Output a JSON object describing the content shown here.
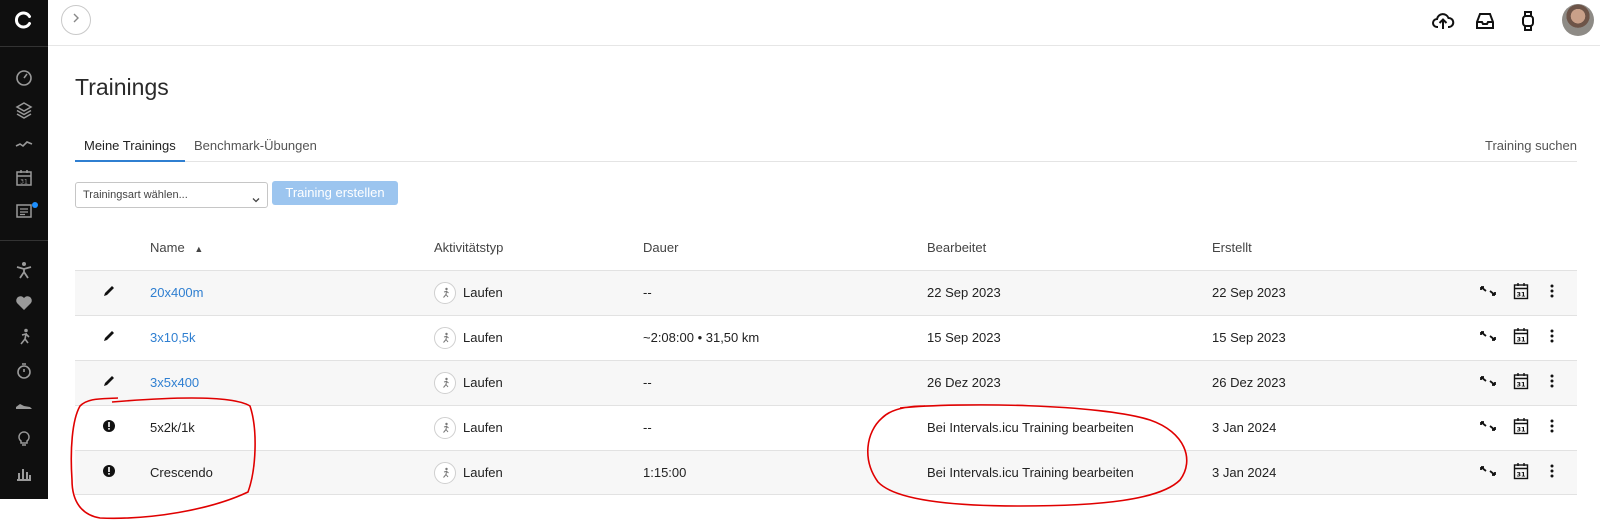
{
  "page": {
    "title": "Trainings"
  },
  "sidebar": {
    "items": [
      {
        "icon": "logo-icon"
      },
      {
        "icon": "dashboard-gauge-icon"
      },
      {
        "icon": "layers-icon"
      },
      {
        "icon": "activity-trend-icon"
      },
      {
        "icon": "calendar-icon",
        "text": "31"
      },
      {
        "icon": "news-icon",
        "has_dot": true
      },
      {
        "icon": "athlete-icon"
      },
      {
        "icon": "heart-icon"
      },
      {
        "icon": "runner-icon"
      },
      {
        "icon": "stopwatch-icon"
      },
      {
        "icon": "shoe-icon"
      },
      {
        "icon": "lightbulb-icon"
      },
      {
        "icon": "bar-chart-icon"
      }
    ]
  },
  "topbar": {
    "icons": [
      "upload-cloud-icon",
      "inbox-icon",
      "watch-icon",
      "user-avatar"
    ]
  },
  "tabs": [
    {
      "label": "Meine Trainings",
      "active": true
    },
    {
      "label": "Benchmark-Übungen",
      "active": false
    }
  ],
  "search_link": "Training suchen",
  "filter": {
    "placeholder": "Trainingsart wählen..."
  },
  "create_button": "Training erstellen",
  "table": {
    "headers": {
      "name": "Name",
      "sort_indicator": "▲",
      "activity_type": "Aktivitätstyp",
      "duration": "Dauer",
      "edited": "Bearbeitet",
      "created": "Erstellt"
    },
    "rows": [
      {
        "icon": "pencil-icon",
        "name": "20x400m",
        "is_link": true,
        "activity": "Laufen",
        "duration": "--",
        "edited": "22 Sep 2023",
        "created": "22 Sep 2023"
      },
      {
        "icon": "pencil-icon",
        "name": "3x10,5k",
        "is_link": true,
        "activity": "Laufen",
        "duration": "~2:08:00 • 31,50 km",
        "edited": "15 Sep 2023",
        "created": "15 Sep 2023"
      },
      {
        "icon": "pencil-icon",
        "name": "3x5x400",
        "is_link": true,
        "activity": "Laufen",
        "duration": "--",
        "edited": "26 Dez 2023",
        "created": "26 Dez 2023"
      },
      {
        "icon": "info-icon",
        "name": "5x2k/1k",
        "is_link": false,
        "activity": "Laufen",
        "duration": "--",
        "edited": "Bei Intervals.icu Training bearbeiten",
        "created": "3 Jan 2024"
      },
      {
        "icon": "info-icon",
        "name": "Crescendo",
        "is_link": false,
        "activity": "Laufen",
        "duration": "1:15:00",
        "edited": "Bei Intervals.icu Training bearbeiten",
        "created": "3 Jan 2024"
      }
    ],
    "row_actions": [
      "move-arrows-icon",
      "calendar-icon",
      "more-vertical-icon"
    ],
    "calendar_day": "31"
  },
  "colors": {
    "sidebar_bg": "#0f0f0f",
    "link": "#2f7fd1",
    "button_bg": "#9cc5ef",
    "annotation": "#e00000"
  }
}
